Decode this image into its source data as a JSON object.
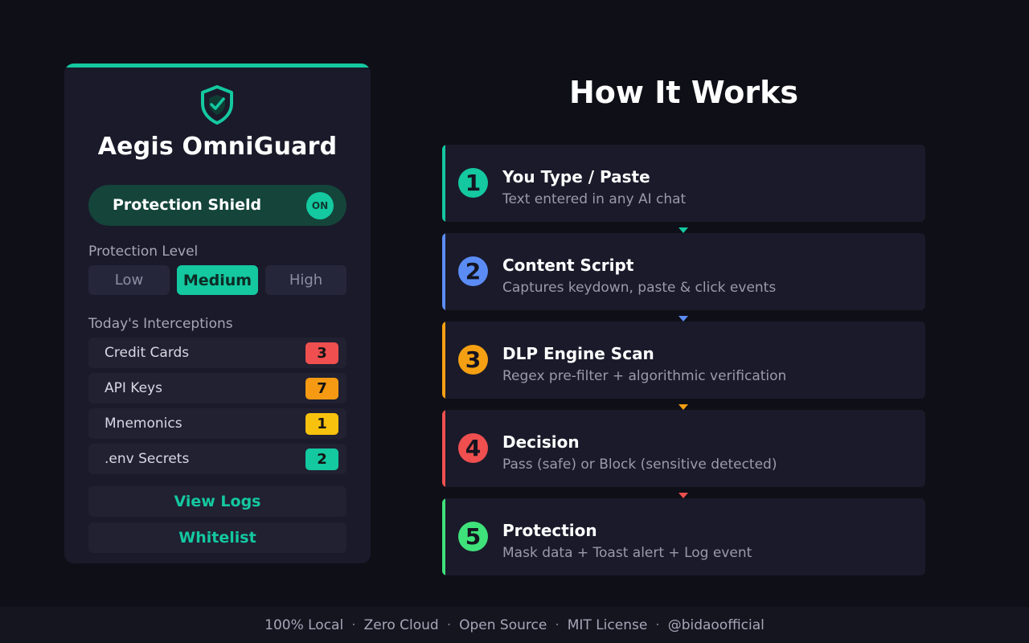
{
  "app": {
    "title": "Aegis OmniGuard",
    "logo_icon": "shield-check-icon",
    "accent_color": "#14c8a0"
  },
  "shield": {
    "label": "Protection Shield",
    "toggle_text": "ON",
    "state": "on"
  },
  "protection_level": {
    "label": "Protection Level",
    "options": [
      "Low",
      "Medium",
      "High"
    ],
    "selected": "Medium"
  },
  "interceptions": {
    "label": "Today's Interceptions",
    "items": [
      {
        "label": "Credit Cards",
        "count": "3",
        "color": "#ef4f4f"
      },
      {
        "label": "API Keys",
        "count": "7",
        "color": "#f59a12"
      },
      {
        "label": ".env Secrets",
        "count": "2",
        "color": "#14c8a0"
      },
      {
        "label": "Mnemonics",
        "count": "1",
        "color": "#f7c20e"
      }
    ]
  },
  "actions": {
    "view_logs": "View Logs",
    "whitelist": "Whitelist"
  },
  "how_it_works": {
    "title": "How It Works",
    "steps": [
      {
        "num": "1",
        "title": "You Type / Paste",
        "desc": "Text entered in any AI chat",
        "color": "#14c8a0"
      },
      {
        "num": "2",
        "title": "Content Script",
        "desc": "Captures keydown, paste & click events",
        "color": "#5b8cf5"
      },
      {
        "num": "3",
        "title": "DLP Engine Scan",
        "desc": "Regex pre-filter + algorithmic verification",
        "color": "#f5a012"
      },
      {
        "num": "4",
        "title": "Decision",
        "desc": "Pass (safe) or Block (sensitive detected)",
        "color": "#ef4f4f"
      },
      {
        "num": "5",
        "title": "Protection",
        "desc": "Mask data + Toast alert + Log event",
        "color": "#3fe27a"
      }
    ]
  },
  "footer": {
    "items": [
      "100% Local",
      "Zero Cloud",
      "Open Source",
      "MIT License",
      "@bidaoofficial"
    ],
    "separator": "·"
  }
}
